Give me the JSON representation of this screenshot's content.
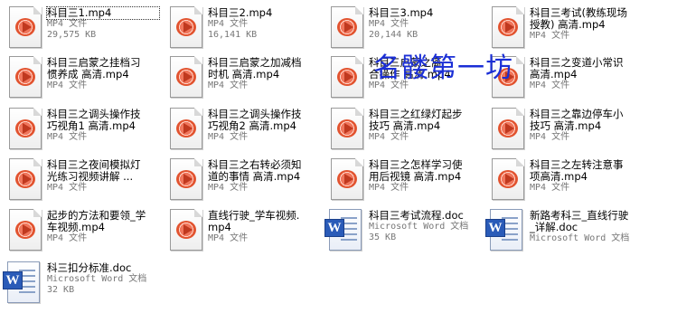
{
  "files": [
    {
      "id": "f1",
      "type": "mp4",
      "name_lines": [
        "科目三1.mp4"
      ],
      "meta": [
        "MP4 文件",
        "29,575 KB"
      ],
      "selected": true
    },
    {
      "id": "f2",
      "type": "mp4",
      "name_lines": [
        "科目三2.mp4"
      ],
      "meta": [
        "MP4 文件",
        "16,141 KB"
      ]
    },
    {
      "id": "f3",
      "type": "mp4",
      "name_lines": [
        "科目三3.mp4"
      ],
      "meta": [
        "MP4 文件",
        "20,144 KB"
      ]
    },
    {
      "id": "f4",
      "type": "mp4",
      "name_lines": [
        "科目三考试(教练现场",
        "授教) 高清.mp4"
      ],
      "meta": [
        "MP4 文件"
      ]
    },
    {
      "id": "f5",
      "type": "mp4",
      "name_lines": [
        "科目三启蒙之挂档习",
        "惯养成 高清.mp4"
      ],
      "meta": [
        "MP4 文件"
      ]
    },
    {
      "id": "f6",
      "type": "mp4",
      "name_lines": [
        "科目三启蒙之加减档",
        "时机 高清.mp4"
      ],
      "meta": [
        "MP4 文件"
      ]
    },
    {
      "id": "f7",
      "type": "mp4",
      "name_lines": [
        "科目三启蒙之离",
        "合操作 高清.mp4"
      ],
      "meta": [
        "MP4 文件"
      ]
    },
    {
      "id": "f8",
      "type": "mp4",
      "name_lines": [
        "科目三之变道小常识",
        "高清.mp4"
      ],
      "meta": [
        "MP4 文件"
      ]
    },
    {
      "id": "f9",
      "type": "mp4",
      "name_lines": [
        "科目三之调头操作技",
        "巧视角1 高清.mp4"
      ],
      "meta": [
        "MP4 文件"
      ]
    },
    {
      "id": "f10",
      "type": "mp4",
      "name_lines": [
        "科目三之调头操作技",
        "巧视角2 高清.mp4"
      ],
      "meta": [
        "MP4 文件"
      ]
    },
    {
      "id": "f11",
      "type": "mp4",
      "name_lines": [
        "科目三之红绿灯起步",
        "技巧 高清.mp4"
      ],
      "meta": [
        "MP4 文件"
      ]
    },
    {
      "id": "f12",
      "type": "mp4",
      "name_lines": [
        "科目三之靠边停车小",
        "技巧 高清.mp4"
      ],
      "meta": [
        "MP4 文件"
      ]
    },
    {
      "id": "f13",
      "type": "mp4",
      "name_lines": [
        "科目三之夜间模拟灯",
        "光练习视频讲解 ..."
      ],
      "meta": [
        "MP4 文件"
      ]
    },
    {
      "id": "f14",
      "type": "mp4",
      "name_lines": [
        "科目三之右转必须知",
        "道的事情 高清.mp4"
      ],
      "meta": [
        "MP4 文件"
      ]
    },
    {
      "id": "f15",
      "type": "mp4",
      "name_lines": [
        "科目三之怎样学习使",
        "用后视镜 高清.mp4"
      ],
      "meta": [
        "MP4 文件"
      ]
    },
    {
      "id": "f16",
      "type": "mp4",
      "name_lines": [
        "科目三之左转注意事",
        "项高清.mp4"
      ],
      "meta": [
        "MP4 文件"
      ]
    },
    {
      "id": "f17",
      "type": "mp4",
      "name_lines": [
        "起步的方法和要领_学",
        "车视频.mp4"
      ],
      "meta": [
        "MP4 文件"
      ]
    },
    {
      "id": "f18",
      "type": "mp4",
      "name_lines": [
        "直线行驶_学车视频.",
        "mp4"
      ],
      "meta": [
        "MP4 文件"
      ]
    },
    {
      "id": "f19",
      "type": "doc",
      "name_lines": [
        "科目三考试流程.doc"
      ],
      "meta": [
        "Microsoft Word 文档",
        "35 KB"
      ]
    },
    {
      "id": "f20",
      "type": "doc",
      "name_lines": [
        "新路考科三_直线行驶",
        "_详解.doc"
      ],
      "meta": [
        "Microsoft Word 文档"
      ]
    },
    {
      "id": "f21",
      "type": "doc",
      "name_lines": [
        "科三扣分标准.doc"
      ],
      "meta": [
        "Microsoft Word 文档",
        "32 KB"
      ]
    }
  ],
  "watermark": "名髅第一坊",
  "icons": {
    "mp4": "video-file-icon",
    "doc": "word-document-icon"
  }
}
